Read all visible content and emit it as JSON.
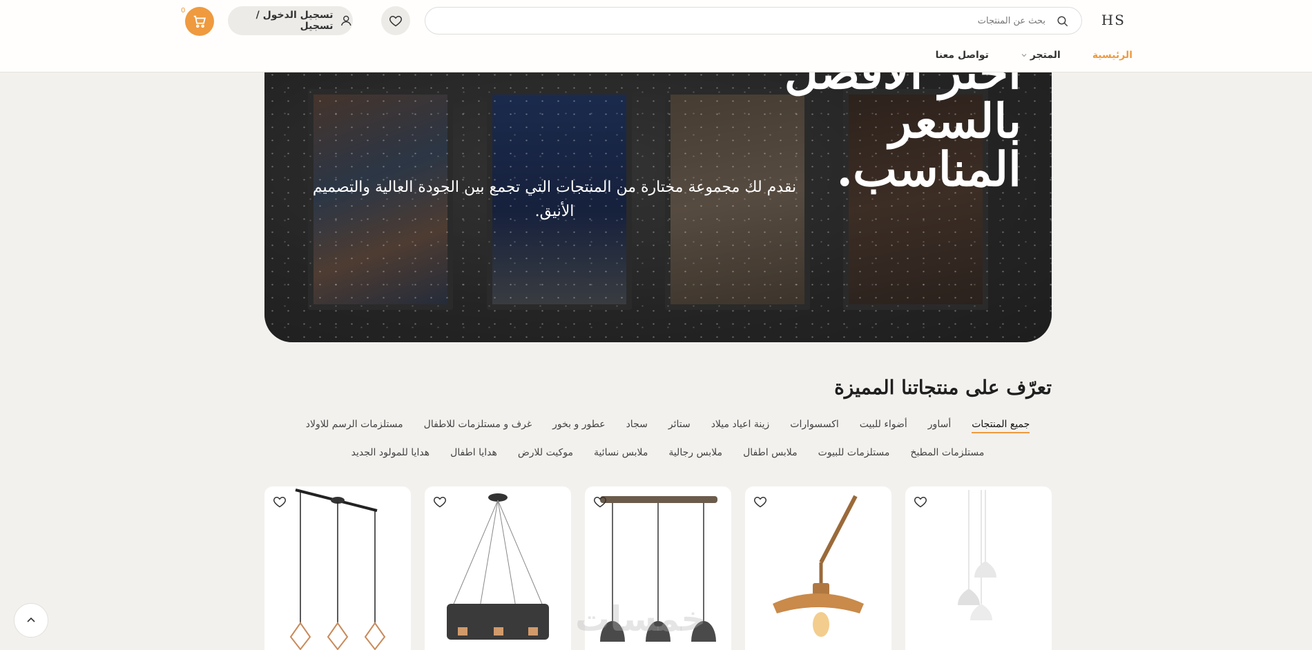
{
  "header": {
    "logo": "HS",
    "search_placeholder": "بحث عن المنتجات",
    "login_label": "تسجيل الدخول / تسجيل",
    "cart_count": "0",
    "nav": [
      {
        "label": "الرئيسية"
      },
      {
        "label": "المتجر"
      },
      {
        "label": "تواصل معنا"
      }
    ]
  },
  "hero": {
    "title": "أختر الأفضل بالسعر المناسب.",
    "subtitle": "نقدم لك مجموعة مختارة من المنتجات التي تجمع بين الجودة العالية والتصميم الأنيق."
  },
  "section": {
    "title": "تعرّف على منتجاتنا المميزة",
    "categories": [
      "جميع المنتجات",
      "أساور",
      "أضواء للبيت",
      "اكسسوارات",
      "زينة اعياد ميلاد",
      "ستائر",
      "سجاد",
      "عطور و بخور",
      "غرف و مستلزمات للاطفال",
      "مستلزمات الرسم للاولاد",
      "مستلزمات المطبخ",
      "مستلزمات للبيوت",
      "ملابس اطفال",
      "ملابس رجالية",
      "ملابس نسائية",
      "موكيت للارض",
      "هدايا اطفال",
      "هدايا للمولود الجديد"
    ]
  },
  "watermark": "خمسات",
  "colors": {
    "accent": "#ef9a3f",
    "hero_bg": "#2e2e2e",
    "page_bg": "#f3f1ee"
  },
  "icons": [
    "search-icon",
    "heart-icon",
    "user-icon",
    "cart-icon",
    "chevron-down-icon",
    "chevron-up-icon"
  ]
}
